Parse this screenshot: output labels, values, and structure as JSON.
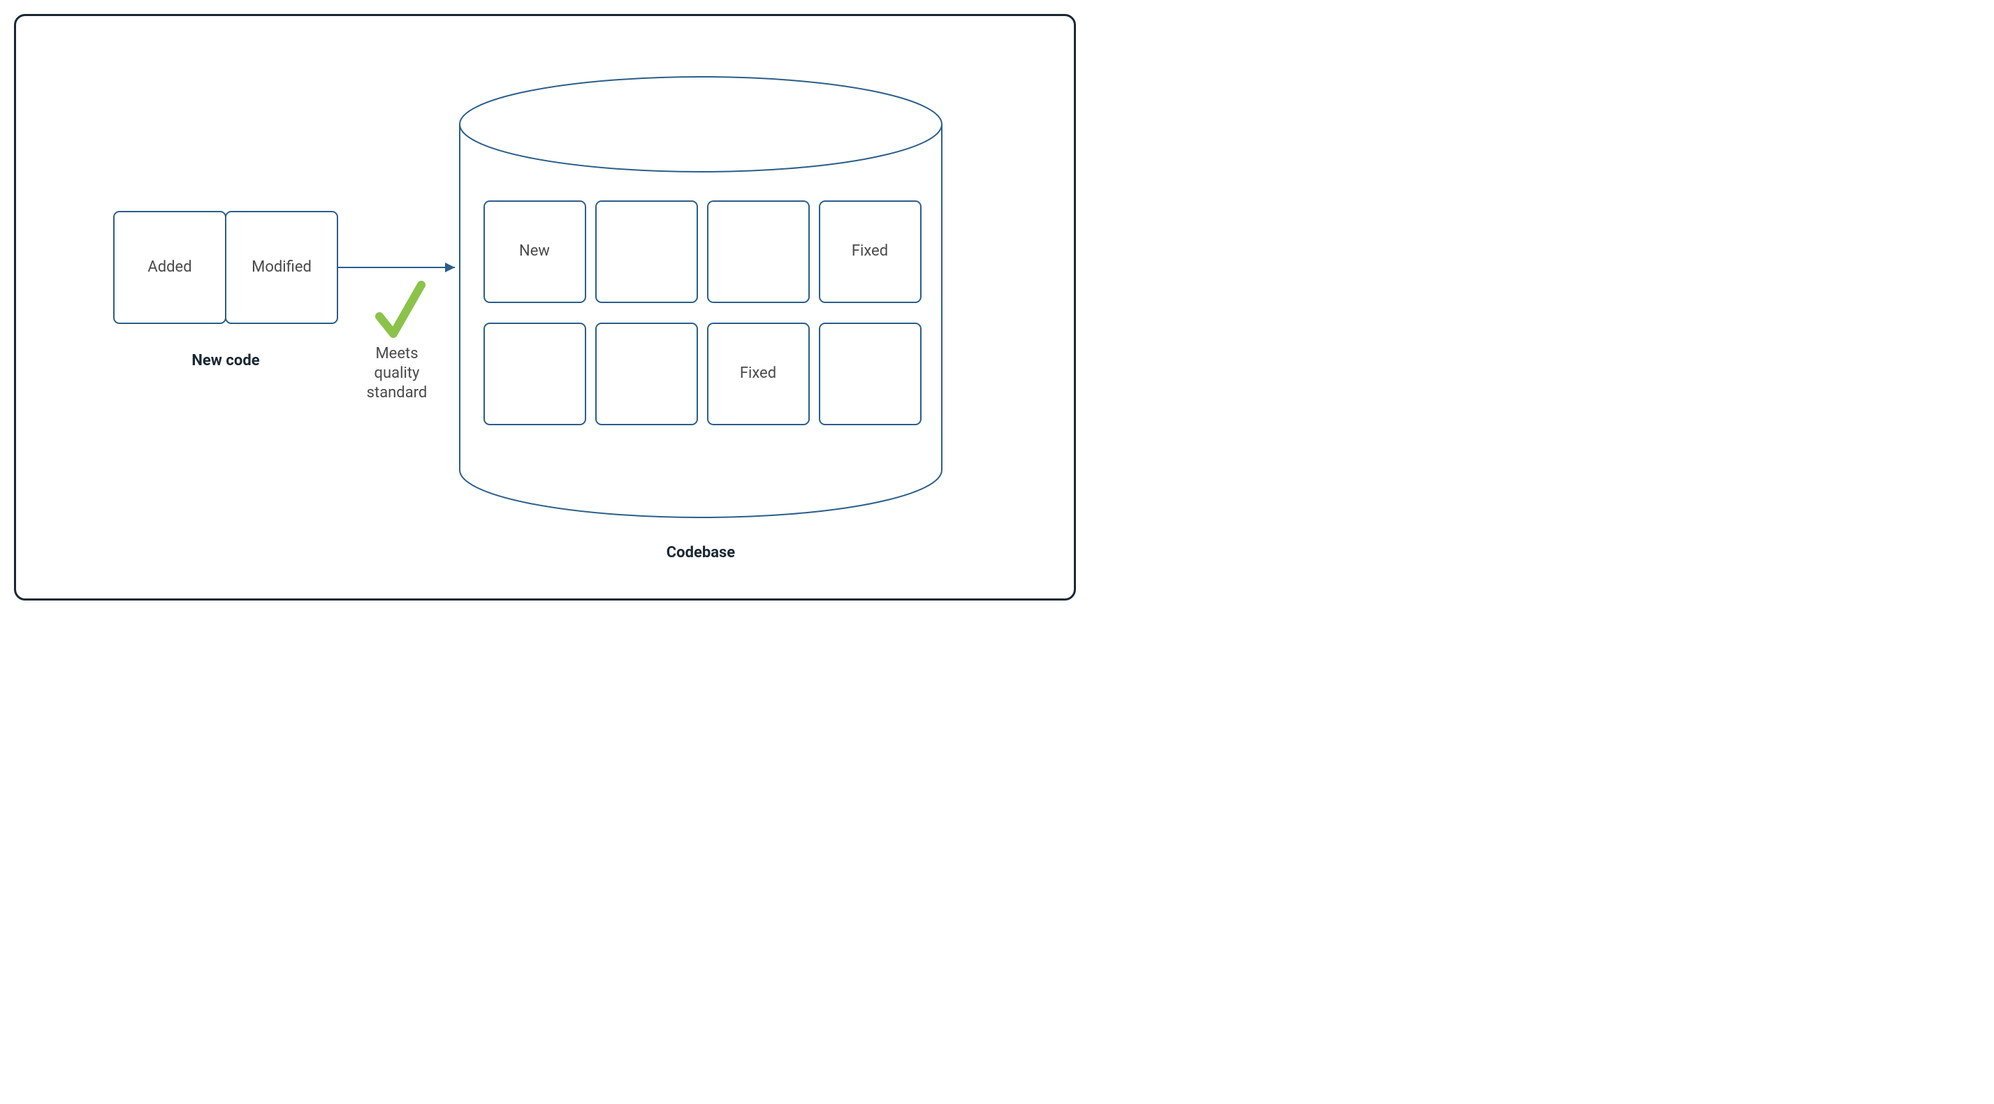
{
  "new_code": {
    "caption": "New code",
    "boxes": [
      {
        "label": "Added"
      },
      {
        "label": "Modified"
      }
    ]
  },
  "quality_gate": {
    "line1": "Meets",
    "line2": "quality",
    "line3": "standard",
    "status": "pass"
  },
  "codebase": {
    "caption": "Codebase",
    "cells": [
      [
        {
          "label": "New"
        },
        {
          "label": ""
        },
        {
          "label": ""
        },
        {
          "label": "Fixed"
        }
      ],
      [
        {
          "label": ""
        },
        {
          "label": ""
        },
        {
          "label": "Fixed"
        },
        {
          "label": ""
        }
      ]
    ]
  },
  "colors": {
    "stroke": "#2b5e8a",
    "check": "#8bc34a",
    "frame": "#1a2833"
  }
}
